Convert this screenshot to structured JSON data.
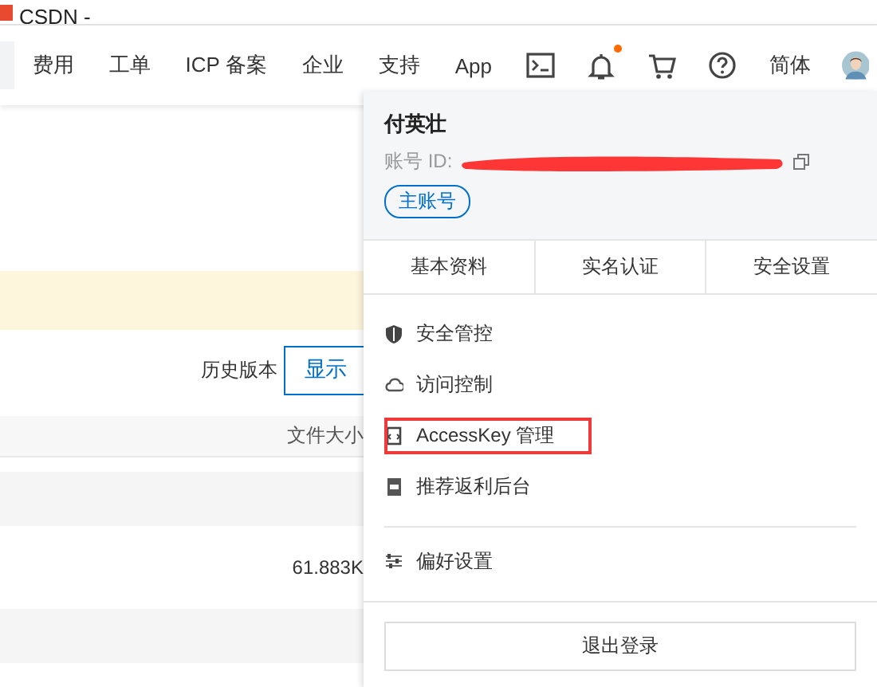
{
  "browser_tab": {
    "title": "CSDN -"
  },
  "nav": {
    "links": [
      "费用",
      "工单",
      "ICP 备案",
      "企业",
      "支持",
      "App"
    ],
    "notification_unread": true,
    "language": "简体"
  },
  "page": {
    "history_label": "历史版本",
    "show_button": "显示",
    "table": {
      "column_1": "文件大小",
      "rows": [
        {
          "size": ""
        },
        {
          "size": "61.883K"
        },
        {
          "size": ""
        }
      ]
    }
  },
  "account_menu": {
    "user_name": "付英壮",
    "account_id_label": "账号 ID:",
    "id_redacted": true,
    "account_type": "主账号",
    "tabs": [
      "基本资料",
      "实名认证",
      "安全设置"
    ],
    "items": [
      {
        "label": "安全管控",
        "highlighted": false
      },
      {
        "label": "访问控制",
        "highlighted": false
      },
      {
        "label": "AccessKey 管理",
        "highlighted": true
      },
      {
        "label": "推荐返利后台",
        "highlighted": false
      }
    ],
    "preferences": "偏好设置",
    "logout": "退出登录"
  }
}
